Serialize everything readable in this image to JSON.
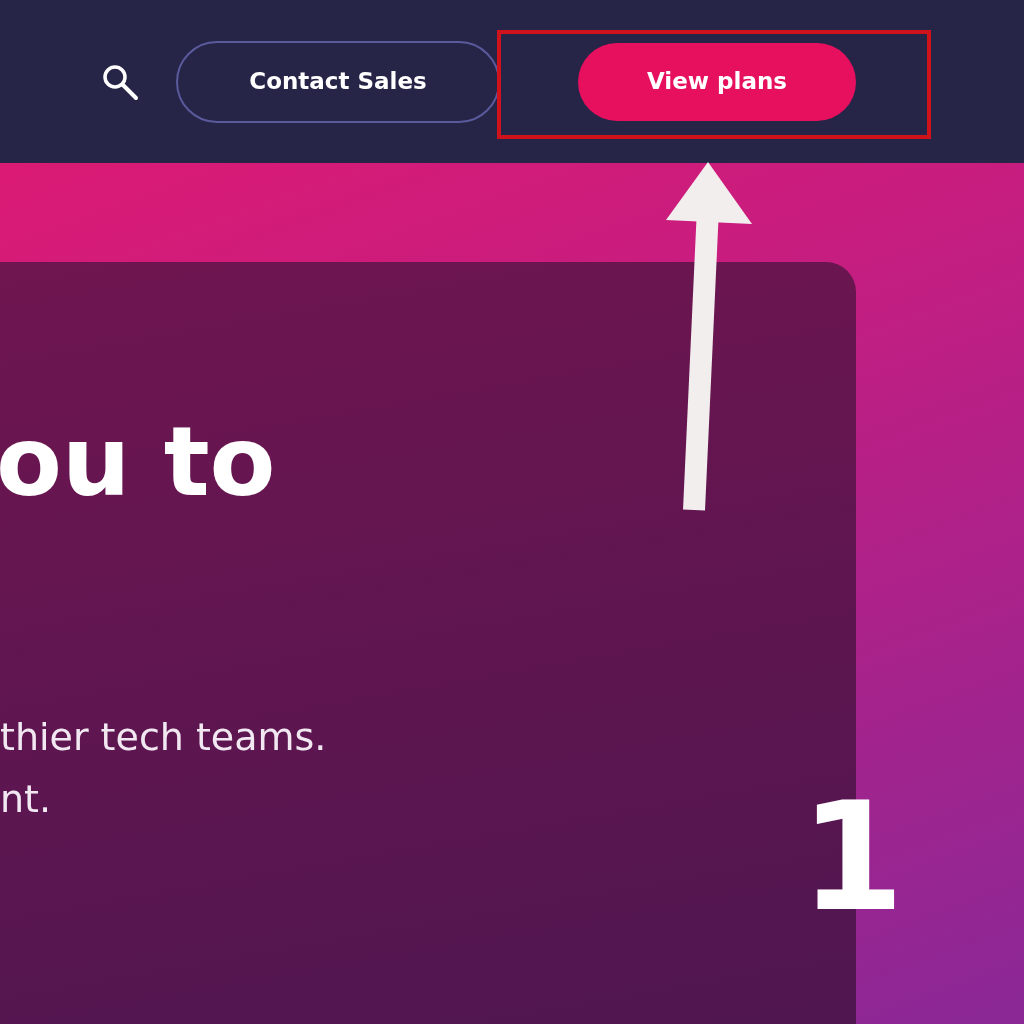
{
  "navbar": {
    "buttons": [
      {
        "kind": "outline",
        "label": "Contact Sales"
      },
      {
        "kind": "primary",
        "label": "View plans"
      }
    ]
  },
  "hero": {
    "heading": "ou to",
    "body_lines": [
      "thier tech teams.",
      "nt."
    ]
  },
  "annotation": {
    "number": "1"
  }
}
